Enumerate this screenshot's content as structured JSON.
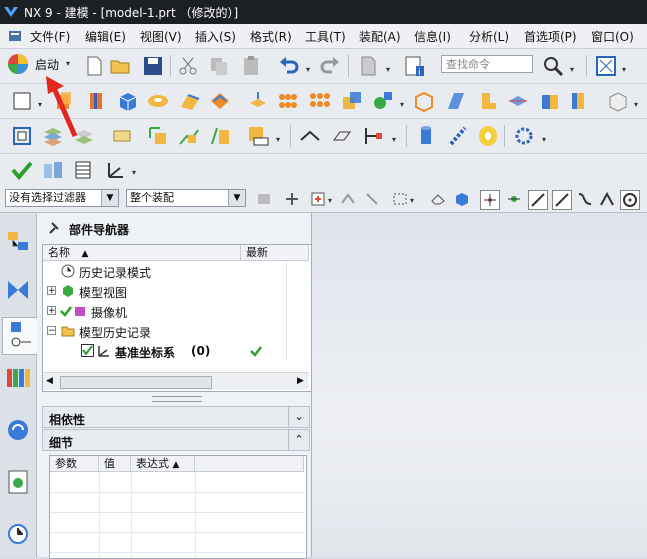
{
  "window": {
    "title": "NX 9 - 建模 - [model-1.prt （修改的）]"
  },
  "menu": {
    "items": [
      "文件(F)",
      "编辑(E)",
      "视图(V)",
      "插入(S)",
      "格式(R)",
      "工具(T)",
      "装配(A)",
      "信息(I)",
      "分析(L)",
      "首选项(P)",
      "窗口(O)"
    ]
  },
  "toolbar": {
    "start_label": "启动",
    "search_placeholder": "查找命令"
  },
  "filterbar": {
    "filter_value": "没有选择过滤器",
    "scope_value": "整个装配"
  },
  "navigator": {
    "title": "部件导航器",
    "col_name": "名称",
    "col_latest": "最新",
    "rows": [
      {
        "label": "历史记录模式"
      },
      {
        "label": "模型视图"
      },
      {
        "label": "摄像机"
      },
      {
        "label": "模型历史记录"
      },
      {
        "label": "基准坐标系",
        "count": "(0)"
      }
    ]
  },
  "sections": {
    "dependency": "相依性",
    "detail": "细节"
  },
  "detail_table": {
    "columns": [
      "参数",
      "值",
      "表达式"
    ]
  },
  "colors": {
    "titlebar": "#1c1f24",
    "check": "#2aa02a",
    "accent": "#3a77c9"
  }
}
